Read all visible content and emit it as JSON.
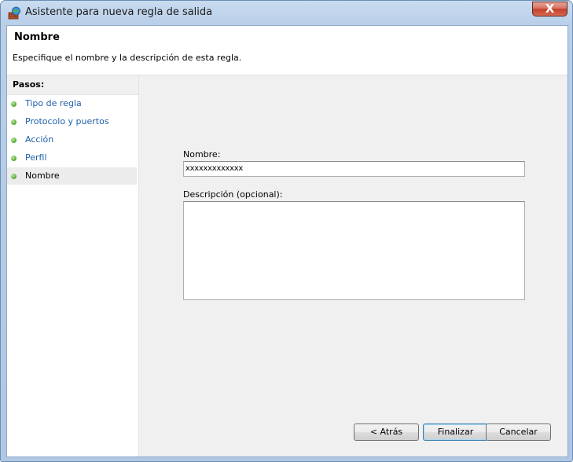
{
  "window": {
    "title": "Asistente para nueva regla de salida",
    "icon": "firewall-wizard-icon",
    "close_glyph": "X"
  },
  "header": {
    "title": "Nombre",
    "description": "Especifique el nombre y la descripción de esta regla."
  },
  "steps": {
    "heading": "Pasos:",
    "items": [
      {
        "label": "Tipo de regla",
        "state": "done"
      },
      {
        "label": "Protocolo y puertos",
        "state": "done"
      },
      {
        "label": "Acción",
        "state": "done"
      },
      {
        "label": "Perfil",
        "state": "done"
      },
      {
        "label": "Nombre",
        "state": "current"
      }
    ],
    "dot_color": "#5fae3c"
  },
  "form": {
    "name_label": "Nombre:",
    "name_value": "xxxxxxxxxxxxx",
    "description_label": "Descripción (opcional):",
    "description_value": ""
  },
  "buttons": {
    "back": "< Atrás",
    "finish": "Finalizar",
    "cancel": "Cancelar"
  }
}
